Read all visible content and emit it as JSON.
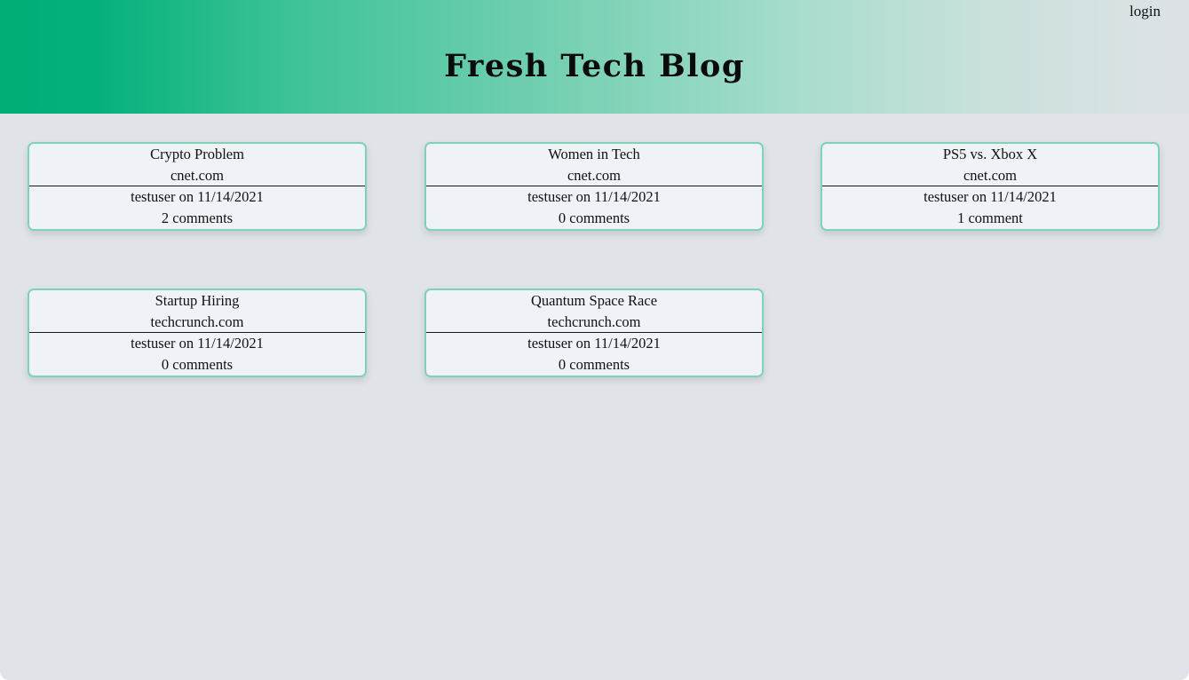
{
  "header": {
    "title": "Fresh Tech Blog",
    "login_label": "login"
  },
  "posts": [
    {
      "title": "Crypto Problem",
      "source": "cnet.com",
      "byline": "testuser on 11/14/2021",
      "comments": "2 comments"
    },
    {
      "title": "Women in Tech",
      "source": "cnet.com",
      "byline": "testuser on 11/14/2021",
      "comments": "0 comments"
    },
    {
      "title": "PS5 vs. Xbox X",
      "source": "cnet.com",
      "byline": "testuser on 11/14/2021",
      "comments": "1 comment"
    },
    {
      "title": "Startup Hiring",
      "source": "techcrunch.com",
      "byline": "testuser on 11/14/2021",
      "comments": "0 comments"
    },
    {
      "title": "Quantum Space Race",
      "source": "techcrunch.com",
      "byline": "testuser on 11/14/2021",
      "comments": "0 comments"
    }
  ],
  "colors": {
    "accent": "#00ad77",
    "card_border": "#7ed3b6",
    "background": "#e0e4e9"
  }
}
